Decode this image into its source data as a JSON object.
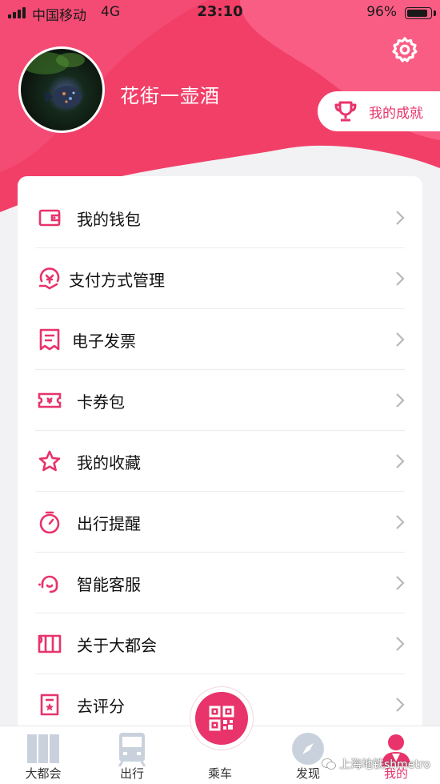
{
  "status_bar": {
    "carrier": "中国移动",
    "network": "4G",
    "time": "23:10",
    "battery_percent": "96%",
    "battery_level": 0.96
  },
  "profile": {
    "username": "花街一壶酒",
    "achievements_label": "我的成就"
  },
  "menu": {
    "items": [
      {
        "label": "我的钱包",
        "icon": "wallet-icon"
      },
      {
        "label": "支付方式管理",
        "icon": "payment-icon"
      },
      {
        "label": "电子发票",
        "icon": "invoice-icon"
      },
      {
        "label": "卡券包",
        "icon": "coupon-icon"
      },
      {
        "label": "我的收藏",
        "icon": "star-icon"
      },
      {
        "label": "出行提醒",
        "icon": "stopwatch-icon"
      },
      {
        "label": "智能客服",
        "icon": "headset-icon"
      },
      {
        "label": "关于大都会",
        "icon": "metro-logo-icon"
      },
      {
        "label": "去评分",
        "icon": "rating-icon"
      }
    ]
  },
  "tab_bar": {
    "tabs": [
      {
        "label": "大都会",
        "icon": "metro-logo-icon"
      },
      {
        "label": "出行",
        "icon": "train-icon"
      },
      {
        "label": "乘车",
        "icon": "qr-code-icon"
      },
      {
        "label": "发现",
        "icon": "compass-icon"
      },
      {
        "label": "我的",
        "icon": "user-icon"
      }
    ],
    "active_index": 4
  },
  "watermark": "上海地铁shmetro",
  "colors": {
    "accent": "#e8336b",
    "header_pink": "#f4426b",
    "header_light": "#fa6a8c"
  }
}
